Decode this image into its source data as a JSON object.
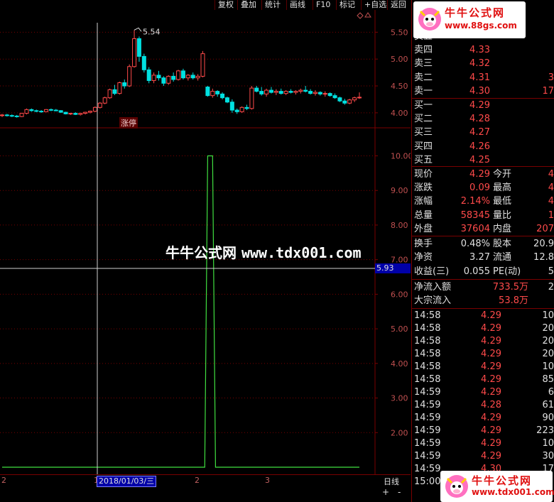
{
  "toolbar": {
    "items": [
      "复权",
      "叠加",
      "统计",
      "画线",
      "F10",
      "标记",
      "+自选",
      "返回"
    ]
  },
  "watermark": {
    "cn": "牛牛公式网",
    "url": "www.tdx001.com"
  },
  "logo": {
    "name": "牛牛公式网",
    "url_top": "www.88gs.com",
    "url_bottom": "www.tdx001.com"
  },
  "price_chart": {
    "y_ticks": [
      "5.50",
      "5.00",
      "4.50",
      "4.00"
    ],
    "high_label": "5.54",
    "event_label": "涨停"
  },
  "indicator_chart": {
    "y_ticks": [
      "10.00",
      "9.00",
      "8.00",
      "7.00",
      "6.00",
      "5.00",
      "4.00",
      "3.00",
      "2.00"
    ],
    "cursor_value": "5.93"
  },
  "x_axis": {
    "labels": [
      "2",
      "1",
      "2",
      "3"
    ],
    "cursor_date": "2018/01/03/三",
    "period": "日线",
    "zoom_in": "+",
    "zoom_out": "-"
  },
  "order_book": {
    "sell": [
      {
        "label": "卖五",
        "price": "",
        "vol": ""
      },
      {
        "label": "卖四",
        "price": "4.33",
        "vol": ""
      },
      {
        "label": "卖三",
        "price": "4.32",
        "vol": ""
      },
      {
        "label": "卖二",
        "price": "4.31",
        "vol": "3"
      },
      {
        "label": "卖一",
        "price": "4.30",
        "vol": "17"
      }
    ],
    "buy": [
      {
        "label": "买一",
        "price": "4.29",
        "vol": ""
      },
      {
        "label": "买二",
        "price": "4.28",
        "vol": ""
      },
      {
        "label": "买三",
        "price": "4.27",
        "vol": ""
      },
      {
        "label": "买四",
        "price": "4.26",
        "vol": ""
      },
      {
        "label": "买五",
        "price": "4.25",
        "vol": ""
      }
    ]
  },
  "quote": [
    {
      "l1": "现价",
      "v1": "4.29",
      "l2": "今开",
      "v2": "4"
    },
    {
      "l1": "涨跌",
      "v1": "0.09",
      "l2": "最高",
      "v2": "4"
    },
    {
      "l1": "涨幅",
      "v1": "2.14%",
      "l2": "最低",
      "v2": "4"
    },
    {
      "l1": "总量",
      "v1": "58345",
      "l2": "量比",
      "v2": "1"
    },
    {
      "l1": "外盘",
      "v1": "37604",
      "l2": "内盘",
      "v2": "207"
    }
  ],
  "fundamentals": [
    {
      "l1": "换手",
      "v1": "0.48%",
      "l2": "股本",
      "v2": "20.9"
    },
    {
      "l1": "净资",
      "v1": "3.27",
      "l2": "流通",
      "v2": "12.8"
    },
    {
      "l1": "收益(三)",
      "v1": "0.055",
      "l2": "PE(动)",
      "v2": "5"
    }
  ],
  "flow": [
    {
      "label": "净流入额",
      "value": "733.5万",
      "extra": "2"
    },
    {
      "label": "大宗流入",
      "value": "53.8万",
      "extra": ""
    }
  ],
  "ticks": [
    {
      "time": "14:58",
      "price": "4.29",
      "vol": "10"
    },
    {
      "time": "14:58",
      "price": "4.29",
      "vol": "20"
    },
    {
      "time": "14:58",
      "price": "4.29",
      "vol": "20"
    },
    {
      "time": "14:58",
      "price": "4.29",
      "vol": "20"
    },
    {
      "time": "14:58",
      "price": "4.29",
      "vol": "10"
    },
    {
      "time": "14:58",
      "price": "4.29",
      "vol": "85"
    },
    {
      "time": "14:59",
      "price": "4.29",
      "vol": "6"
    },
    {
      "time": "14:59",
      "price": "4.28",
      "vol": "61"
    },
    {
      "time": "14:59",
      "price": "4.29",
      "vol": "90"
    },
    {
      "time": "14:59",
      "price": "4.29",
      "vol": "223"
    },
    {
      "time": "14:59",
      "price": "4.29",
      "vol": "10"
    },
    {
      "time": "14:59",
      "price": "4.29",
      "vol": "30"
    },
    {
      "time": "14:59",
      "price": "4.30",
      "vol": "17"
    },
    {
      "time": "15:00",
      "price": "",
      "vol": ""
    }
  ],
  "colors": {
    "up": "#ff4a4a",
    "down": "#00e0e0",
    "indicator": "#40e040",
    "grid": "#7a0000"
  },
  "chart_data": [
    {
      "type": "candlestick",
      "ylim": [
        3.8,
        5.65
      ],
      "candles": [
        [
          3.95,
          3.98,
          3.92,
          3.96
        ],
        [
          3.96,
          3.98,
          3.93,
          3.95
        ],
        [
          3.95,
          3.97,
          3.92,
          3.94
        ],
        [
          3.94,
          3.96,
          3.91,
          3.93
        ],
        [
          3.93,
          4.0,
          3.92,
          3.99
        ],
        [
          3.99,
          4.08,
          3.97,
          4.06
        ],
        [
          4.06,
          4.08,
          4.02,
          4.04
        ],
        [
          4.04,
          4.06,
          4.01,
          4.03
        ],
        [
          4.03,
          4.05,
          4.0,
          4.02
        ],
        [
          4.02,
          4.07,
          4.01,
          4.06
        ],
        [
          4.06,
          4.08,
          4.03,
          4.05
        ],
        [
          4.05,
          4.07,
          4.03,
          4.04
        ],
        [
          4.04,
          4.05,
          4.0,
          4.01
        ],
        [
          4.01,
          4.02,
          3.97,
          3.98
        ],
        [
          3.98,
          4.0,
          3.96,
          3.99
        ],
        [
          3.99,
          4.01,
          3.96,
          3.97
        ],
        [
          3.97,
          4.0,
          3.95,
          3.99
        ],
        [
          3.99,
          4.02,
          3.97,
          4.01
        ],
        [
          4.01,
          4.04,
          3.99,
          4.03
        ],
        [
          4.03,
          4.12,
          4.01,
          4.1
        ],
        [
          4.1,
          4.2,
          4.08,
          4.18
        ],
        [
          4.18,
          4.3,
          4.16,
          4.28
        ],
        [
          4.28,
          4.45,
          4.26,
          4.43
        ],
        [
          4.43,
          4.52,
          4.33,
          4.36
        ],
        [
          4.36,
          4.58,
          4.34,
          4.56
        ],
        [
          4.56,
          4.62,
          4.45,
          4.5
        ],
        [
          4.5,
          4.9,
          4.48,
          4.86
        ],
        [
          4.86,
          5.54,
          4.84,
          5.38
        ],
        [
          5.38,
          5.42,
          4.95,
          5.05
        ],
        [
          5.05,
          5.1,
          4.75,
          4.8
        ],
        [
          4.8,
          4.85,
          4.55,
          4.6
        ],
        [
          4.6,
          4.75,
          4.55,
          4.7
        ],
        [
          4.7,
          4.78,
          4.6,
          4.65
        ],
        [
          4.65,
          4.68,
          4.5,
          4.55
        ],
        [
          4.55,
          4.7,
          4.52,
          4.68
        ],
        [
          4.68,
          4.75,
          4.58,
          4.62
        ],
        [
          4.62,
          4.8,
          4.6,
          4.78
        ],
        [
          4.78,
          4.82,
          4.62,
          4.65
        ],
        [
          4.65,
          4.72,
          4.6,
          4.7
        ],
        [
          4.7,
          4.75,
          4.62,
          4.65
        ],
        [
          4.65,
          4.72,
          4.6,
          4.68
        ],
        [
          4.68,
          5.15,
          4.66,
          5.1
        ],
        [
          4.48,
          4.5,
          4.3,
          4.32
        ],
        [
          4.32,
          4.45,
          4.28,
          4.4
        ],
        [
          4.4,
          4.42,
          4.3,
          4.35
        ],
        [
          4.35,
          4.38,
          4.25,
          4.28
        ],
        [
          4.28,
          4.3,
          4.18,
          4.2
        ],
        [
          4.2,
          4.25,
          4.0,
          4.05
        ],
        [
          4.05,
          4.08,
          3.98,
          4.02
        ],
        [
          4.02,
          4.12,
          4.0,
          4.1
        ],
        [
          4.1,
          4.15,
          4.05,
          4.08
        ],
        [
          4.08,
          4.5,
          4.06,
          4.46
        ],
        [
          4.46,
          4.5,
          4.38,
          4.4
        ],
        [
          4.4,
          4.48,
          4.32,
          4.35
        ],
        [
          4.35,
          4.45,
          4.3,
          4.42
        ],
        [
          4.42,
          4.48,
          4.36,
          4.38
        ],
        [
          4.38,
          4.44,
          4.33,
          4.4
        ],
        [
          4.4,
          4.45,
          4.34,
          4.36
        ],
        [
          4.36,
          4.42,
          4.33,
          4.4
        ],
        [
          4.4,
          4.44,
          4.36,
          4.38
        ],
        [
          4.38,
          4.42,
          4.34,
          4.4
        ],
        [
          4.4,
          4.45,
          4.36,
          4.42
        ],
        [
          4.42,
          4.5,
          4.38,
          4.4
        ],
        [
          4.4,
          4.44,
          4.34,
          4.36
        ],
        [
          4.36,
          4.42,
          4.32,
          4.38
        ],
        [
          4.38,
          4.4,
          4.32,
          4.35
        ],
        [
          4.35,
          4.4,
          4.3,
          4.36
        ],
        [
          4.36,
          4.38,
          4.3,
          4.32
        ],
        [
          4.32,
          4.36,
          4.26,
          4.28
        ],
        [
          4.28,
          4.3,
          4.2,
          4.22
        ],
        [
          4.22,
          4.26,
          4.15,
          4.18
        ],
        [
          4.18,
          4.26,
          4.16,
          4.24
        ],
        [
          4.24,
          4.3,
          4.2,
          4.28
        ],
        [
          4.28,
          4.38,
          4.26,
          4.29
        ]
      ]
    },
    {
      "type": "line",
      "ylim": [
        1.0,
        10.4
      ],
      "series": [
        {
          "values": [
            1.0,
            1.0,
            1.0,
            1.0,
            1.0,
            1.0,
            1.0,
            1.0,
            1.0,
            1.0,
            1.0,
            1.0,
            1.0,
            1.0,
            1.0,
            1.0,
            1.0,
            1.0,
            1.0,
            1.0,
            1.0,
            1.0,
            1.0,
            1.0,
            1.0,
            1.0,
            1.0,
            1.0,
            1.0,
            1.0,
            1.0,
            1.0,
            1.0,
            1.0,
            1.0,
            1.0,
            1.0,
            1.0,
            1.0,
            1.0,
            1.0,
            1.0,
            1.0,
            1.0,
            1.0,
            1.0,
            1.0,
            1.0,
            1.0,
            1.0,
            1.0,
            1.0,
            1.0,
            1.0,
            1.0,
            1.0,
            1.0,
            1.0,
            1.0,
            1.0,
            1.0,
            1.0,
            1.0,
            1.0,
            1.0,
            1.0,
            1.0,
            1.0,
            1.0,
            1.0,
            1.0,
            1.0,
            1.0,
            1.0
          ]
        }
      ],
      "spike": {
        "start_index": 41,
        "peak_start": 42,
        "peak_end": 43,
        "end_index": 44,
        "peak": 10.0
      }
    }
  ]
}
